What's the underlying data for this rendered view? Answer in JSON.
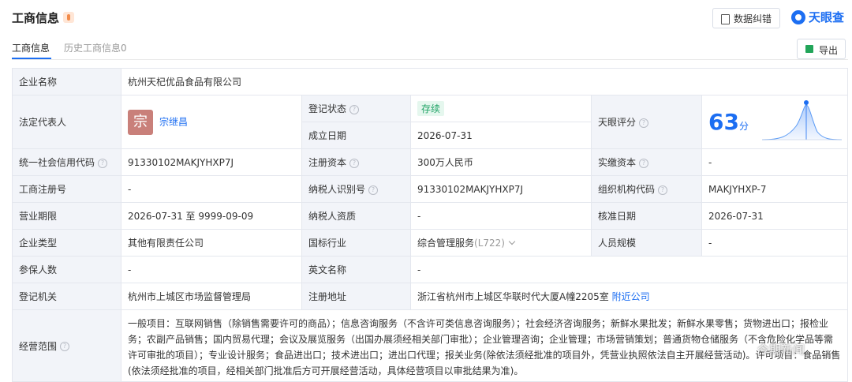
{
  "header": {
    "title": "工商信息",
    "correct_button": "数据纠错",
    "brand": "天眼查"
  },
  "tabs": [
    {
      "label": "工商信息"
    },
    {
      "label": "历史工商信息0"
    }
  ],
  "export_button": "导出",
  "company": {
    "name_label": "企业名称",
    "name_value": "杭州天杞优品食品有限公司",
    "legal_rep_label": "法定代表人",
    "legal_rep_avatar": "宗",
    "legal_rep_name": "宗继昌",
    "reg_status_label": "登记状态",
    "reg_status_value": "存续",
    "est_date_label": "成立日期",
    "est_date_value": "2026-07-31",
    "score_label": "天眼评分",
    "score_value": "63",
    "score_unit": "分",
    "credit_code_label": "统一社会信用代码",
    "credit_code_value": "91330102MAKJYHXP7J",
    "reg_capital_label": "注册资本",
    "reg_capital_value": "300万人民币",
    "paid_capital_label": "实缴资本",
    "paid_capital_value": "-",
    "biz_reg_no_label": "工商注册号",
    "biz_reg_no_value": "-",
    "taxpayer_id_label": "纳税人识别号",
    "taxpayer_id_value": "91330102MAKJYHXP7J",
    "org_code_label": "组织机构代码",
    "org_code_value": "MAKJYHXP-7",
    "term_label": "营业期限",
    "term_value": "2026-07-31 至 9999-09-09",
    "taxpayer_qual_label": "纳税人资质",
    "taxpayer_qual_value": "-",
    "approve_date_label": "核准日期",
    "approve_date_value": "2026-07-31",
    "type_label": "企业类型",
    "type_value": "其他有限责任公司",
    "industry_label": "国标行业",
    "industry_value": "综合管理服务",
    "industry_code": "(L722)",
    "staff_label": "人员规模",
    "staff_value": "-",
    "insured_label": "参保人数",
    "insured_value": "-",
    "english_label": "英文名称",
    "english_value": "-",
    "authority_label": "登记机关",
    "authority_value": "杭州市上城区市场监督管理局",
    "address_label": "注册地址",
    "address_value": "浙江省杭州市上城区华联时代大厦A幢2205室",
    "nearby_link": "附近公司",
    "scope_label": "经营范围",
    "scope_value": "一般项目：互联网销售（除销售需要许可的商品）；信息咨询服务（不含许可类信息咨询服务）；社会经济咨询服务；新鲜水果批发；新鲜水果零售；货物进出口；报检业务；农副产品销售；国内贸易代理；会议及展览服务（出国办展须经相关部门审批）；企业管理咨询；企业管理；市场营销策划；普通货物仓储服务（不含危险化学品等需许可审批的项目）；专业设计服务；食品进出口；技术进出口；进出口代理；报关业务(除依法须经批准的项目外，凭营业执照依法自主开展经营活动)。许可项目：食品销售(依法须经批准的项目，经相关部门批准后方可开展经营活动，具体经营项目以审批结果为准)。"
  },
  "watermark": "今期新闻"
}
